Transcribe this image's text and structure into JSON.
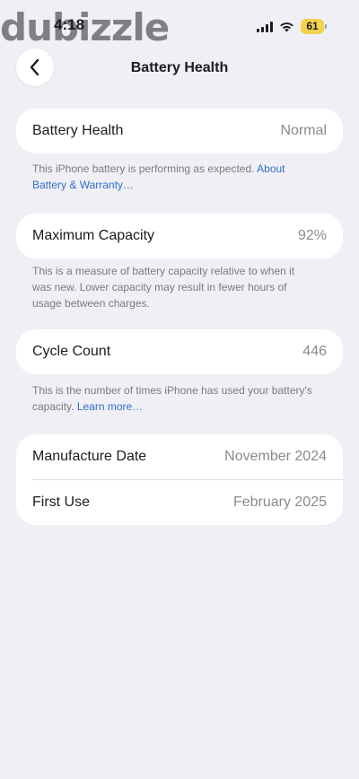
{
  "status_bar": {
    "time": "4:18",
    "watermark": "dubizzle",
    "battery_percent": "61"
  },
  "nav": {
    "title": "Battery Health"
  },
  "battery_health": {
    "label": "Battery Health",
    "value": "Normal",
    "footnote": "This iPhone battery is performing as expected. ",
    "link": "About Battery & Warranty…"
  },
  "maximum_capacity": {
    "label": "Maximum Capacity",
    "value": "92%",
    "footnote": "This is a measure of battery capacity relative to when it was new. Lower capacity may result in fewer hours of usage between charges."
  },
  "cycle_count": {
    "label": "Cycle Count",
    "value": "446",
    "footnote": "This is the number of times iPhone has used your battery's capacity. ",
    "link": "Learn more…"
  },
  "dates": {
    "manufacture_label": "Manufacture Date",
    "manufacture_value": "November 2024",
    "first_use_label": "First Use",
    "first_use_value": "February 2025"
  },
  "colors": {
    "background": "#f0eff5",
    "card": "#ffffff",
    "link": "#2f6fc7",
    "battery_indicator": "#f2d34a"
  },
  "icons": {
    "back": "chevron-left-icon",
    "signal": "cellular-signal-icon",
    "wifi": "wifi-icon",
    "battery": "battery-icon"
  }
}
